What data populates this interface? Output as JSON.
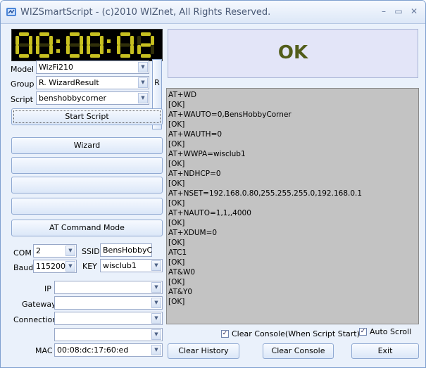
{
  "window": {
    "title": "WIZSmartScript - (c)2010 WIZnet, All Rights Reserved.",
    "minimize": "–",
    "maximize": "▭",
    "close": "✕"
  },
  "clock": {
    "digits": [
      "0",
      "0",
      "0",
      "0",
      "0",
      "2"
    ]
  },
  "model": {
    "label": "Model",
    "value": "WizFi210"
  },
  "group": {
    "label": "Group",
    "value": "R. WizardResult"
  },
  "script": {
    "label": "Script",
    "value": "benshobbycorner"
  },
  "r_button": "R",
  "start_script": "Start Script",
  "wizard": "Wizard",
  "at_mode": "AT Command Mode",
  "com": {
    "label": "COM",
    "value": "2"
  },
  "baud": {
    "label": "Baud",
    "value": "115200"
  },
  "ssid": {
    "label": "SSID",
    "value": "BensHobbyCo"
  },
  "key": {
    "label": "KEY",
    "value": "wisclub1"
  },
  "ip": {
    "label": "IP",
    "value": ""
  },
  "gateway": {
    "label": "Gateway",
    "value": ""
  },
  "connection": {
    "label": "Connection",
    "value": ""
  },
  "extra": {
    "value": ""
  },
  "mac": {
    "label": "MAC",
    "value": "00:08:dc:17:60:ed"
  },
  "status": {
    "text": "OK",
    "color": "#525d1a"
  },
  "console_lines": [
    "AT+WD",
    "[OK]",
    "AT+WAUTO=0,BensHobbyCorner",
    "[OK]",
    "AT+WAUTH=0",
    "[OK]",
    "AT+WWPA=wisclub1",
    "[OK]",
    "AT+NDHCP=0",
    "[OK]",
    "AT+NSET=192.168.0.80,255.255.255.0,192.168.0.1",
    "[OK]",
    "AT+NAUTO=1,1,,4000",
    "[OK]",
    "AT+XDUM=0",
    "[OK]",
    "ATC1",
    "[OK]",
    "AT&W0",
    "[OK]",
    "AT&Y0",
    "[OK]"
  ],
  "clear_console_option": {
    "label": "Clear Console(When Script Start)",
    "checked": true
  },
  "auto_scroll": {
    "label": "Auto Scroll",
    "checked": true
  },
  "clear_history": "Clear History",
  "clear_console": "Clear Console",
  "exit": "Exit"
}
